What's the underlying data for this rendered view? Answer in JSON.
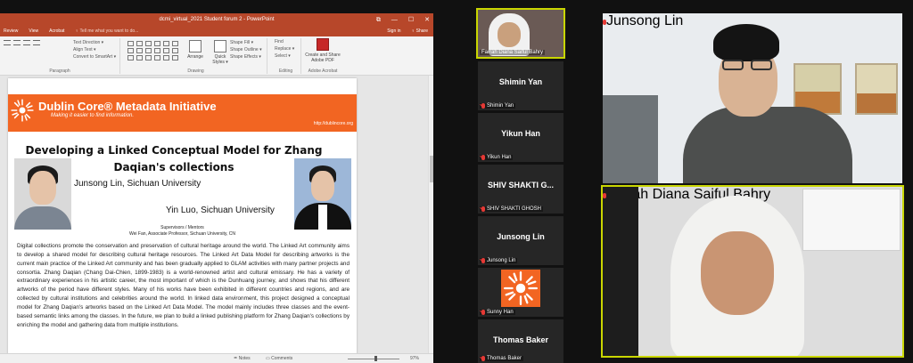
{
  "ppt": {
    "window_title": "dcmi_virtual_2021 Student forum 2 - PowerPoint",
    "window_controls": [
      "⧉",
      "—",
      "☐",
      "✕"
    ],
    "tabs": [
      "Review",
      "View",
      "Acrobat"
    ],
    "tell_me": "♀ Tell me what you want to do...",
    "sign_in": "Sign in",
    "share": "♀ Share",
    "ribbon": {
      "paragraph_items": [
        "Text Direction ▾",
        "Align Text ▾",
        "Convert to SmartArt ▾"
      ],
      "paragraph_label": "Paragraph",
      "drawing_label": "Drawing",
      "arrange_label": "Arrange",
      "quick_styles_label": "Quick Styles ▾",
      "shape_items": [
        "Shape Fill ▾",
        "Shape Outline ▾",
        "Shape Effects ▾"
      ],
      "editing_items": [
        "Find",
        "Replace ▾",
        "Select ▾"
      ],
      "editing_label": "Editing",
      "acrobat_button": "Create and Share Adobe PDF",
      "acrobat_label": "Adobe Acrobat"
    },
    "status": {
      "notes": "≐ Notes",
      "comments": "▭ Comments",
      "zoom": "97%"
    }
  },
  "slide": {
    "org_name": "Dublin Core® Metadata Initiative",
    "tagline": "Making it easier to find information.",
    "url": "http://dublincore.org",
    "title_line1": "Developing a Linked Conceptual Model for Zhang",
    "title_line2": "Daqian's collections",
    "author1": "Junsong Lin, Sichuan University",
    "author2": "Yin Luo, Sichuan University",
    "supervisors_heading": "Supervisors / Mentors",
    "supervisor": "Wei Fan, Associate Professor, Sichuan University, CN",
    "abstract": "Digital collections promote the conservation and preservation of cultural heritage around the world. The Linked Art community aims to develop a shared model for describing cultural heritage resources. The Linked Art Data Model for describing artworks is the current main practice of the Linked Art community and has been gradually applied to GLAM activities with many partner projects and consortia. Zhang Daqian (Chang Dai-Chien, 1899-1983) is a world-renowned artist and cultural emissary. He has a variety of extraordinary experiences in his artistic career, the most important of which is the Dunhuang journey, and shows that his different artworks of the period have different styles. Many of his works have been exhibited in different countries and regions, and are collected by cultural institutions and celebrities around the world. In linked data environment, this project designed a conceptual model for Zhang Daqian's artworks based on the Linked Art Data Model. The model mainly includes three classes and the event-based semantic links among the classes. In the future, we plan to build a linked publishing platform for Zhang Daqian's collections by enriching the model and gathering data from multiple institutions."
  },
  "participants": {
    "farrah": {
      "label": "Farrah Diana Saiful Bahry"
    },
    "shimin": {
      "big": "Shimin Yan",
      "label": "Shimin Yan"
    },
    "yikun": {
      "big": "Yikun Han",
      "label": "Yikun Han"
    },
    "shiv": {
      "big": "SHIV SHAKTI G...",
      "label": "SHIV SHAKTI GHOSH"
    },
    "junsong": {
      "big": "Junsong Lin",
      "label": "Junsong Lin"
    },
    "sunny": {
      "label": "Sunny Han"
    },
    "thomas": {
      "big": "Thomas Baker",
      "label": "Thomas Baker"
    },
    "junsong_video": {
      "label": "Junsong Lin"
    },
    "farrah_video": {
      "label": "Farrah Diana Saiful Bahry"
    }
  },
  "colors": {
    "dcmi_orange": "#f26522",
    "ppt_red": "#b7472a",
    "active_speaker": "#c9d600",
    "muted_mic": "#e53935"
  }
}
